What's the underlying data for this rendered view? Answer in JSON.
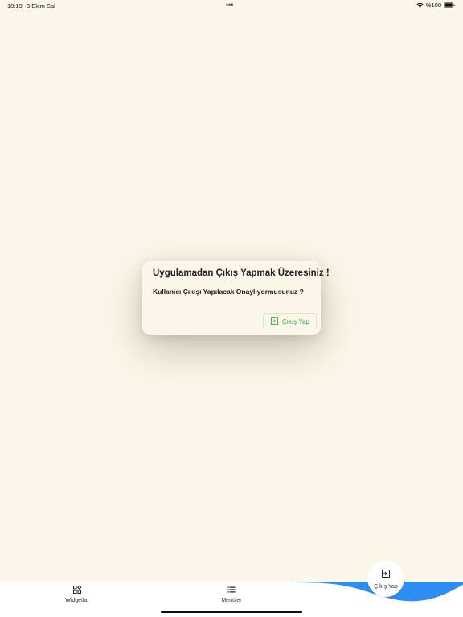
{
  "status_bar": {
    "time": "10:19",
    "date": "3 Ekim Sal",
    "dots": "•••",
    "battery_text": "%100"
  },
  "dialog": {
    "title": "Uygulamadan Çıkış Yapmak Üzeresiniz !",
    "message": "Kullanıcı Çıkışı Yapılacak Onaylıyormusunuz ?",
    "button_label": "Çıkış Yap"
  },
  "bottom_nav": {
    "widgets_label": "Widgetlar",
    "menus_label": "Menüler",
    "logout_label": "Çıkış Yap"
  },
  "colors": {
    "background": "#fdf7e9",
    "accent_green": "#3aa54a",
    "wave_blue": "#2f8cf0"
  },
  "icons": {
    "wifi": "wifi-icon",
    "battery": "battery-icon",
    "logout": "logout-icon",
    "widgets": "widgets-grid-icon",
    "menus": "list-icon"
  }
}
